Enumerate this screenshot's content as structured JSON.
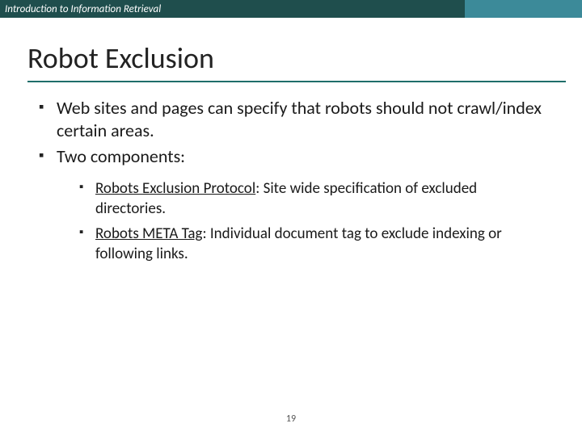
{
  "header": {
    "course": "Introduction to Information Retrieval"
  },
  "title": "Robot Exclusion",
  "bullets": [
    {
      "text": "Web sites and pages can specify that robots should not crawl/index certain areas."
    },
    {
      "text": "Two components:"
    }
  ],
  "subbullets": [
    {
      "term": "Robots Exclusion Protocol",
      "rest": ": Site wide specification of excluded directories."
    },
    {
      "term": "Robots META Tag",
      "rest": ": Individual document tag to exclude indexing or following links."
    }
  ],
  "page_number": "19"
}
